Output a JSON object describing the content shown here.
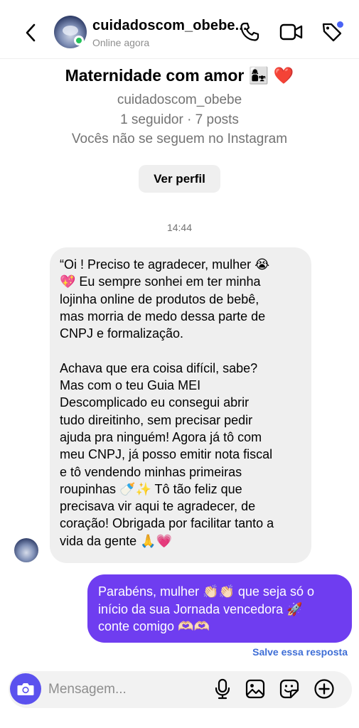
{
  "header": {
    "username": "cuidadoscom_obebe...",
    "status": "Online agora"
  },
  "profile": {
    "title": "Maternidade com amor",
    "title_emoji": "👩‍👧",
    "title_heart": "❤️",
    "handle": "cuidadoscom_obebe",
    "stats": "1 seguidor · 7 posts",
    "follow_note": "Vocês não se seguem no Instagram",
    "view_profile_label": "Ver perfil"
  },
  "thread": {
    "timestamp": "14:44",
    "incoming_message": "“Oi ! Preciso te agradecer, mulher 😭\n💖 Eu sempre sonhei em ter minha\nlojinha online de produtos de bebê,\nmas morria de medo dessa parte de\nCNPJ e formalização.\n\nAchava que era coisa difícil, sabe?\nMas com o teu Guia MEI\nDescomplicado eu consegui abrir\ntudo direitinho, sem precisar pedir\najuda pra ninguém! Agora já tô com\nmeu CNPJ, já posso emitir nota fiscal\ne tô vendendo minhas primeiras\nroupinhas 🍼✨ Tô tão feliz que\nprecisava vir aqui te agradecer, de\ncoração! Obrigada por facilitar tanto a\nvida da gente 🙏💗",
    "outgoing_message": "Parabéns, mulher 👏🏻👏🏻 que seja só o\ninício da sua Jornada vencedora 🚀\nconte comigo 🫶🏻🫶🏻",
    "save_reply_label": "Salve essa resposta"
  },
  "composer": {
    "placeholder": "Mensagem..."
  },
  "colors": {
    "outgoing_bubble": "#6f3df0",
    "incoming_bubble": "#efefef",
    "camera_button": "#5b51ee",
    "online_dot": "#24c25a",
    "link": "#3e6ed6"
  },
  "icons": [
    "back-chevron-icon",
    "phone-icon",
    "video-camera-icon",
    "tag-icon",
    "camera-icon",
    "microphone-icon",
    "image-icon",
    "sticker-icon",
    "add-plus-icon"
  ]
}
